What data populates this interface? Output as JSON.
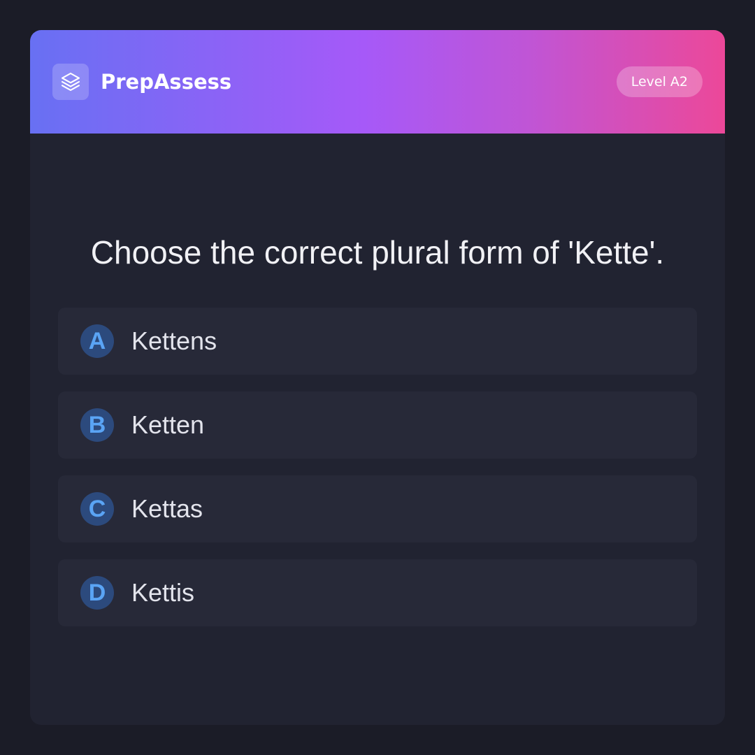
{
  "header": {
    "brand": "PrepAssess",
    "logo_icon": "layers-icon",
    "level_badge": "Level A2",
    "gradient_colors": [
      "#6870f3",
      "#a659f8",
      "#ec4899"
    ]
  },
  "question": {
    "text": "Choose the correct plural form of 'Kette'."
  },
  "options": [
    {
      "letter": "A",
      "text": "Kettens"
    },
    {
      "letter": "B",
      "text": "Ketten"
    },
    {
      "letter": "C",
      "text": "Kettas"
    },
    {
      "letter": "D",
      "text": "Kettis"
    }
  ],
  "colors": {
    "page_background": "#1b1c27",
    "card_background": "#212331",
    "option_background": "#272938",
    "letter_badge_background": "#2c4a7d",
    "letter_badge_text": "#5aa4f5"
  }
}
